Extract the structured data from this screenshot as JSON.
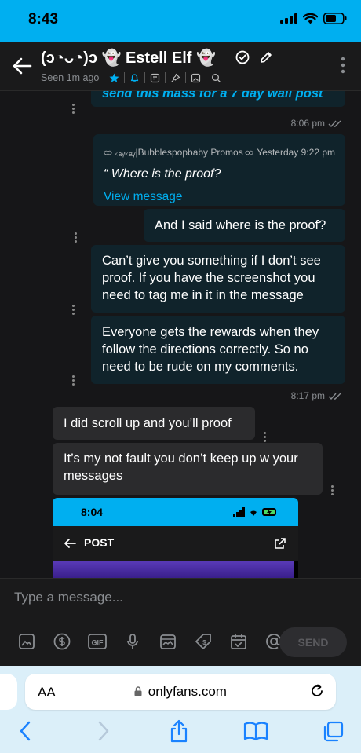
{
  "status_bar": {
    "time": "8:43"
  },
  "header": {
    "title": "(ↄ◔ᴗ◔)ↄ 👻 Estell Elf 👻",
    "seen": "Seen 1m ago"
  },
  "messages": [
    {
      "id": "m0",
      "text": "send this mass for a 7 day wall post",
      "time": "8:06 pm"
    },
    {
      "id": "quote",
      "source": "ₖₐᵧₖₐᵧ|Bubblespopbaby Promos",
      "time": "Yesterday 9:22 pm",
      "text": "“ Where is the proof?",
      "link": "View message"
    },
    {
      "id": "m1",
      "text": "And I said where is the proof?"
    },
    {
      "id": "m2",
      "text": "Can’t give you something if I don’t see proof. If you have the screenshot you need to tag me in it in the message"
    },
    {
      "id": "m3",
      "text": "Everyone gets the rewards when they follow the directions correctly. So no need to be rude on my comments.",
      "time": "8:17 pm"
    },
    {
      "id": "m4",
      "text": "I did scroll up and you’ll proof"
    },
    {
      "id": "m5",
      "text": "It’s my not fault you don’t keep up w your messages"
    }
  ],
  "embedded_screenshot": {
    "time": "8:04",
    "title": "POST"
  },
  "input": {
    "placeholder": "Type a message...",
    "send_label": "SEND"
  },
  "safari": {
    "aa": "AA",
    "url": "onlyfans.com"
  },
  "colors": {
    "brand": "#00aff0",
    "bubble_out": "#10232b",
    "bubble_in": "#2b2b2d"
  },
  "icons": [
    "back-arrow-icon",
    "verified-icon",
    "pencil-icon",
    "more-vertical-icon",
    "star-icon",
    "bell-icon",
    "note-icon",
    "pin-icon",
    "gallery-icon",
    "search-icon",
    "image-icon",
    "dollar-icon",
    "gif-icon",
    "microphone-icon",
    "vault-icon",
    "price-tag-icon",
    "calendar-icon",
    "at-icon",
    "lock-icon",
    "reload-icon",
    "chevron-left-icon",
    "chevron-right-icon",
    "share-icon",
    "bookmarks-icon",
    "tabs-icon"
  ]
}
